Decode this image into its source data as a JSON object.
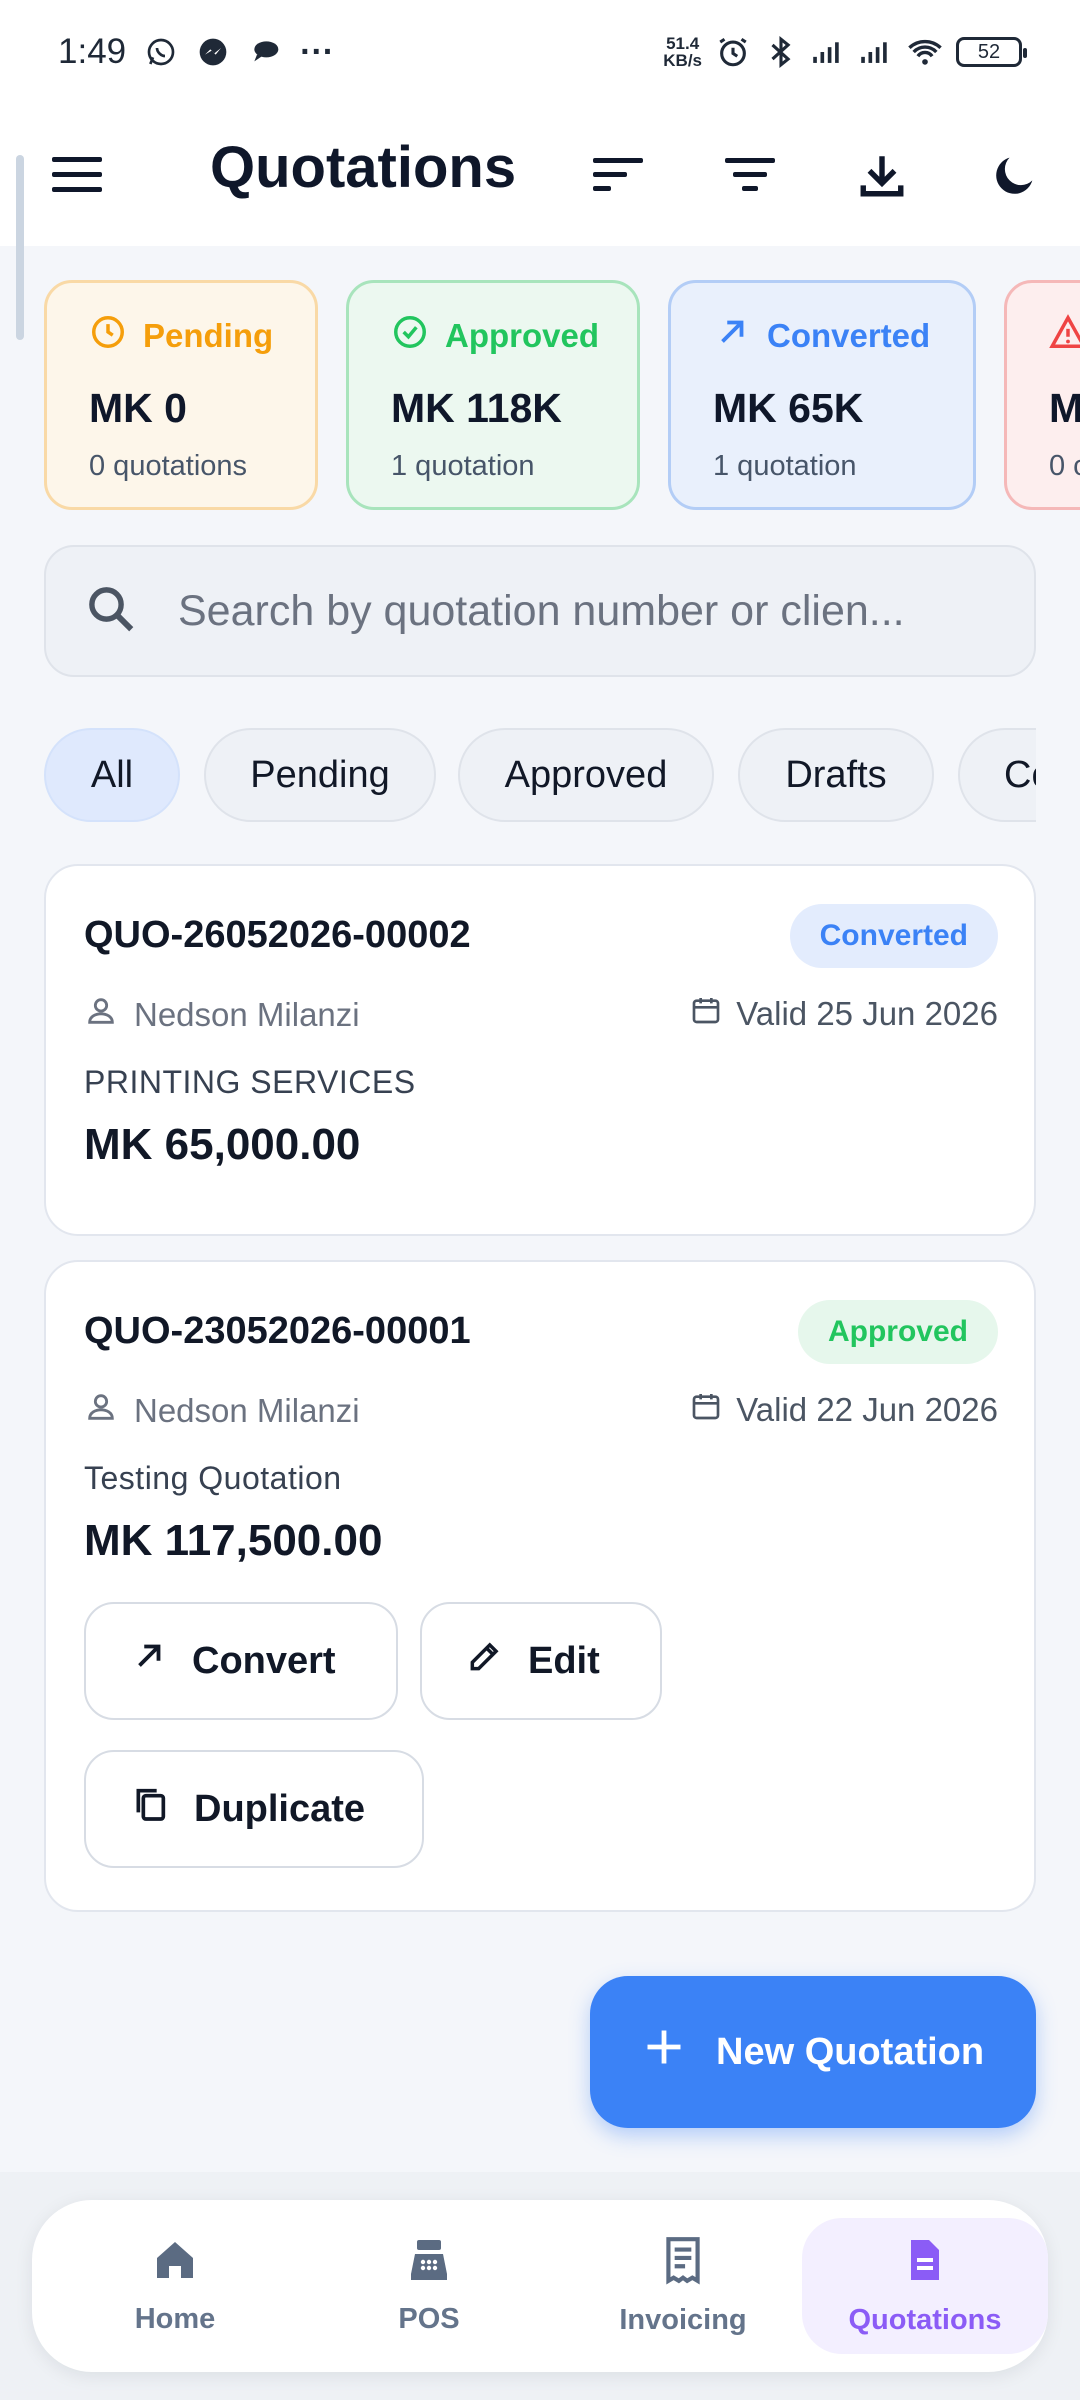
{
  "status_bar": {
    "time": "1:49",
    "net_speed_value": "51.4",
    "net_speed_unit": "KB/s",
    "battery": "52",
    "more": "···"
  },
  "app_bar": {
    "title": "Quotations",
    "icons": [
      "menu-icon",
      "sort-icon",
      "filter-icon",
      "download-icon",
      "dark-mode-icon"
    ]
  },
  "stats": [
    {
      "label": "Pending",
      "amount": "MK 0",
      "count": "0 quotations",
      "color": "#f59e0b",
      "icon": "clock-icon"
    },
    {
      "label": "Approved",
      "amount": "MK 118K",
      "count": "1 quotation",
      "color": "#22c55e",
      "icon": "check-circle-icon"
    },
    {
      "label": "Converted",
      "amount": "MK 65K",
      "count": "1 quotation",
      "color": "#3b82f6",
      "icon": "arrow-up-right-icon"
    },
    {
      "label": "",
      "amount": "M",
      "count": "0 c",
      "color": "#ef4444",
      "icon": "warning-icon"
    }
  ],
  "search": {
    "placeholder": "Search by quotation number or clien..."
  },
  "filters": [
    "All",
    "Pending",
    "Approved",
    "Drafts",
    "Co"
  ],
  "quotations": [
    {
      "number": "QUO-26052026-00002",
      "status": "Converted",
      "status_color": "#3b82f6",
      "client": "Nedson Milanzi",
      "valid": "Valid 25 Jun 2026",
      "description": "PRINTING SERVICES",
      "amount": "MK 65,000.00"
    },
    {
      "number": "QUO-23052026-00001",
      "status": "Approved",
      "status_color": "#22c55e",
      "client": "Nedson Milanzi",
      "valid": "Valid 22 Jun 2026",
      "description": "Testing Quotation",
      "amount": "MK 117,500.00",
      "actions": {
        "convert": "Convert",
        "edit": "Edit",
        "duplicate": "Duplicate"
      }
    }
  ],
  "fab": {
    "label": "New Quotation"
  },
  "bottom_nav": [
    {
      "label": "Home",
      "icon": "home-icon"
    },
    {
      "label": "POS",
      "icon": "cash-register-icon"
    },
    {
      "label": "Invoicing",
      "icon": "receipt-icon"
    },
    {
      "label": "Quotations",
      "icon": "document-icon",
      "active": true
    }
  ],
  "colors": {
    "accent": "#3b82f6",
    "nav_active": "#8b5cf6"
  }
}
